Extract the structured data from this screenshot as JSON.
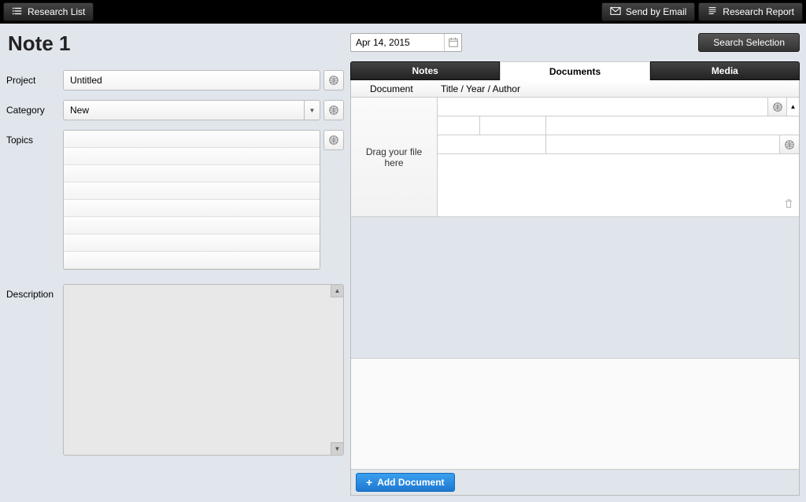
{
  "topbar": {
    "research_list": "Research List",
    "send_email": "Send by Email",
    "research_report": "Research Report"
  },
  "left": {
    "title": "Note 1",
    "labels": {
      "project": "Project",
      "category": "Category",
      "topics": "Topics",
      "description": "Description"
    },
    "project_value": "Untitled",
    "category_value": "New"
  },
  "right": {
    "date": "Apr 14, 2015",
    "search_selection": "Search Selection",
    "tabs": {
      "notes": "Notes",
      "documents": "Documents",
      "media": "Media"
    },
    "doc_header": {
      "document": "Document",
      "tya": "Title / Year / Author"
    },
    "drop_text": "Drag your file here",
    "add_document": "Add Document"
  }
}
